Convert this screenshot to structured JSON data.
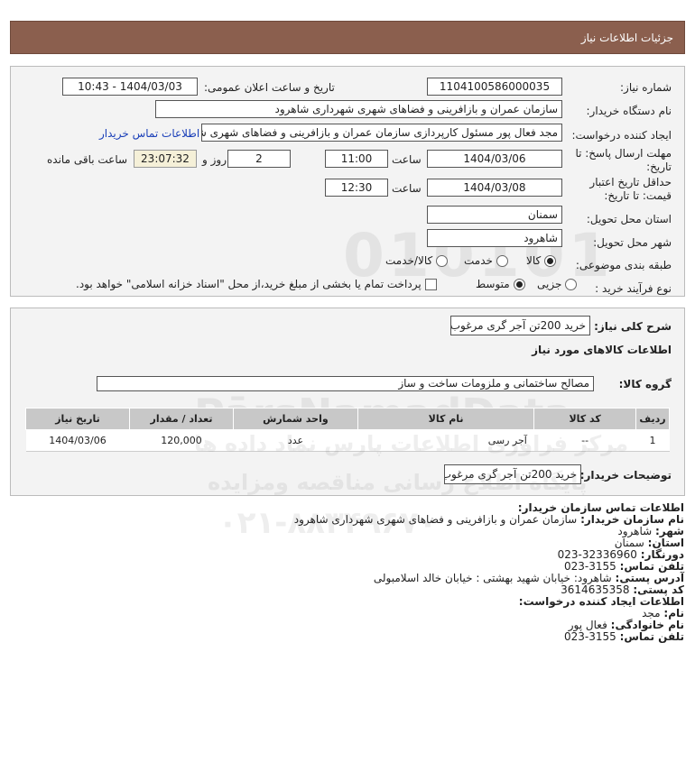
{
  "header": {
    "title": "جزئیات اطلاعات نیاز"
  },
  "form": {
    "need_number_label": "شماره نیاز:",
    "need_number": "1104100586000035",
    "announce_label": "تاریخ و ساعت اعلان عمومی:",
    "announce_value": "1404/03/03 - 10:43",
    "buyer_org_label": "نام دستگاه خریدار:",
    "buyer_org": "سازمان عمران و بازافرینی و فضاهای شهری شهرداری شاهرود",
    "creator_label": "ایجاد کننده درخواست:",
    "creator": "مجد فعال پور مسئول کارپردازی سازمان عمران و بازافرینی و فضاهای شهری شه",
    "contact_link": "اطلاعات تماس خریدار",
    "reply_deadline_label": "مهلت ارسال پاسخ: تا تاریخ:",
    "reply_date": "1404/03/06",
    "time_label": "ساعت",
    "reply_time": "11:00",
    "days_value": "2",
    "days_label": "روز و",
    "remaining_value": "23:07:32",
    "remaining_label": "ساعت باقی مانده",
    "price_validity_label": "حداقل تاریخ اعتبار قیمت: تا تاریخ:",
    "validity_date": "1404/03/08",
    "validity_time": "12:30",
    "province_label": "استان محل تحویل:",
    "province": "سمنان",
    "city_label": "شهر محل تحویل:",
    "city": "شاهرود",
    "category_label": "طبقه بندی موضوعی:",
    "category_options": [
      "کالا",
      "خدمت",
      "کالا/خدمت"
    ],
    "process_label": "نوع فرآیند خرید :",
    "process_options": [
      "جزیی",
      "متوسط"
    ],
    "payment_note": "پرداخت تمام یا بخشی از مبلغ خرید،از محل \"اسناد خزانه اسلامی\" خواهد بود."
  },
  "summary": {
    "label": "شرح کلی نیاز:",
    "value": "خرید 200تن آجر گری مرغوب",
    "goods_info_title": "اطلاعات کالاهای مورد نیاز",
    "group_label": "گروه کالا:",
    "group_value": "مصالح ساختمانی و ملزومات ساخت  و ساز",
    "columns": [
      "ردیف",
      "کد کالا",
      "نام کالا",
      "واحد شمارش",
      "تعداد / مقدار",
      "تاریخ نیاز"
    ],
    "rows": [
      {
        "row": "1",
        "code": "--",
        "name": "آجر رسی",
        "unit": "عدد",
        "qty": "120,000",
        "date": "1404/03/06"
      }
    ],
    "buyer_desc_label": "توضیحات خریدار:",
    "buyer_desc": "خرید 200تن آجر گری مرغوب"
  },
  "contact": {
    "title": "اطلاعات تماس سازمان خریدار:",
    "org_label": "نام سازمان خریدار:",
    "org": "سازمان عمران و بازافرینی و فضاهای شهری شهرداری شاهرود",
    "city_label": "شهر:",
    "city": "شاهرود",
    "province_label": "استان:",
    "province": "سمنان",
    "fax_label": "دورنگار:",
    "fax": "32336960-023",
    "phone_label": "تلفن تماس:",
    "phone": "3155-023",
    "address_label": "آدرس پستی:",
    "address": "شاهرود: خیابان شهید بهشتی : خیابان خالد اسلامبولی",
    "postal_label": "کد پستی:",
    "postal": "3614635358",
    "creator_title": "اطلاعات ایجاد کننده درخواست:",
    "name_label": "نام:",
    "name": "مجد",
    "family_label": "نام خانوادگی:",
    "family": "فعال پور",
    "creator_phone_label": "تلفن تماس:",
    "creator_phone": "3155-023"
  },
  "watermark": {
    "brand": "PārsNamadData",
    "line1": "مرکز فراوری اطلاعات پارس نماد داده ها",
    "line2": "پایگاه اطلاع رسانی مناقصه ومزایده",
    "line3": "۰۲۱-۸۸۳۴۹۶۷۰",
    "digits": "010101"
  }
}
